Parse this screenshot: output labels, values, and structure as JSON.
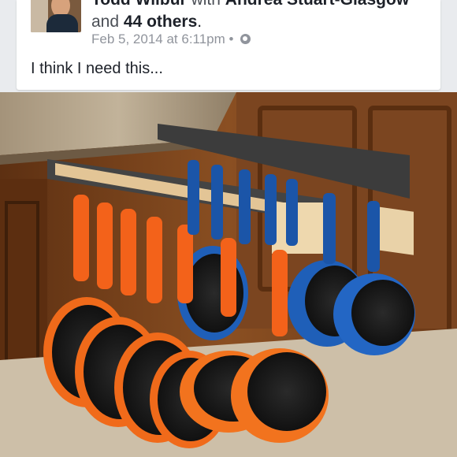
{
  "post": {
    "author": "Todd Wilbur",
    "with_word": "with",
    "tagged": "Andrea Stuart-Glasgow",
    "and_word": "and",
    "others": "44 others",
    "period": ".",
    "timestamp": "Feb 5, 2014 at 6:11pm",
    "separator": "•",
    "privacy_icon": "globe-icon",
    "text": "I think I need this..."
  },
  "photo": {
    "subject": "pull-out cabinet pot rack with hanging orange and blue pans"
  },
  "colors": {
    "background": "#e9ebee",
    "card": "#ffffff",
    "text": "#1d2129",
    "meta": "#90949c",
    "cabinet": "#7a4a22",
    "orange_pan": "#f06a1a",
    "blue_pan": "#1f5fb8"
  }
}
